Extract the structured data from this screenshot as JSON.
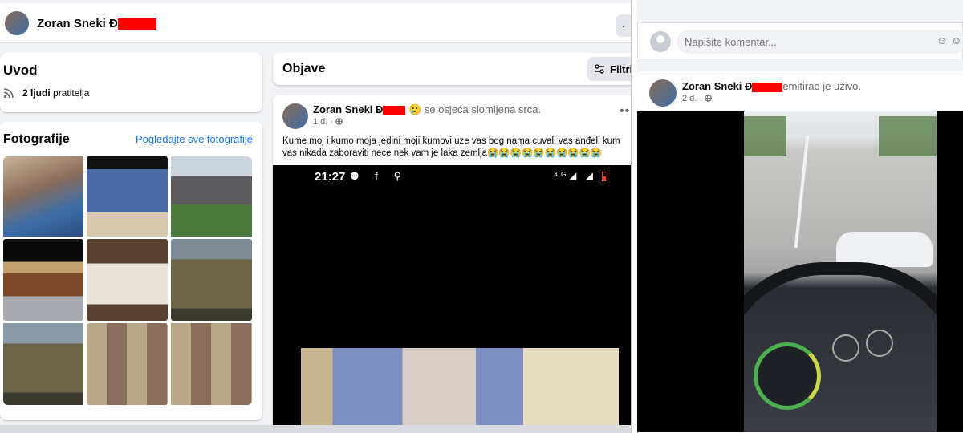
{
  "profile": {
    "name": "Zoran Sneki Đ",
    "more_glyph": "·"
  },
  "intro": {
    "title": "Uvod",
    "followers_count": "2 ljudi",
    "followers_label": "pratitelja"
  },
  "photos": {
    "title": "Fotografije",
    "see_all": "Pogledajte sve fotografije"
  },
  "posts": {
    "title": "Objave",
    "filter_label": "Filtri"
  },
  "post": {
    "author": "Zoran Sneki Đ",
    "feeling_emoji": "🥲",
    "feeling": "se osjeća slomljena srca.",
    "time": "1 d. ·",
    "text": "Kume moj i kumo moja jedini moji kumovi uze vas bog nama cuvali vas anđeli kum\nvas nikada zaboraviti nece nek vam je laka zemlja😭😭😭😭😭😭😭😭😭😭",
    "phone_time": "21:27",
    "phone_icons": "⚉ f ⚲",
    "phone_right": "⁴ᴳ◢ ◢"
  },
  "comment": {
    "placeholder": "Napišite komentar..."
  },
  "live_post": {
    "author": "Zoran Sneki Đ",
    "action": "emitirao je uživo.",
    "time": "2 d. ·"
  },
  "colors": {
    "accent": "#1877f2",
    "redaction": "#ff0000"
  }
}
